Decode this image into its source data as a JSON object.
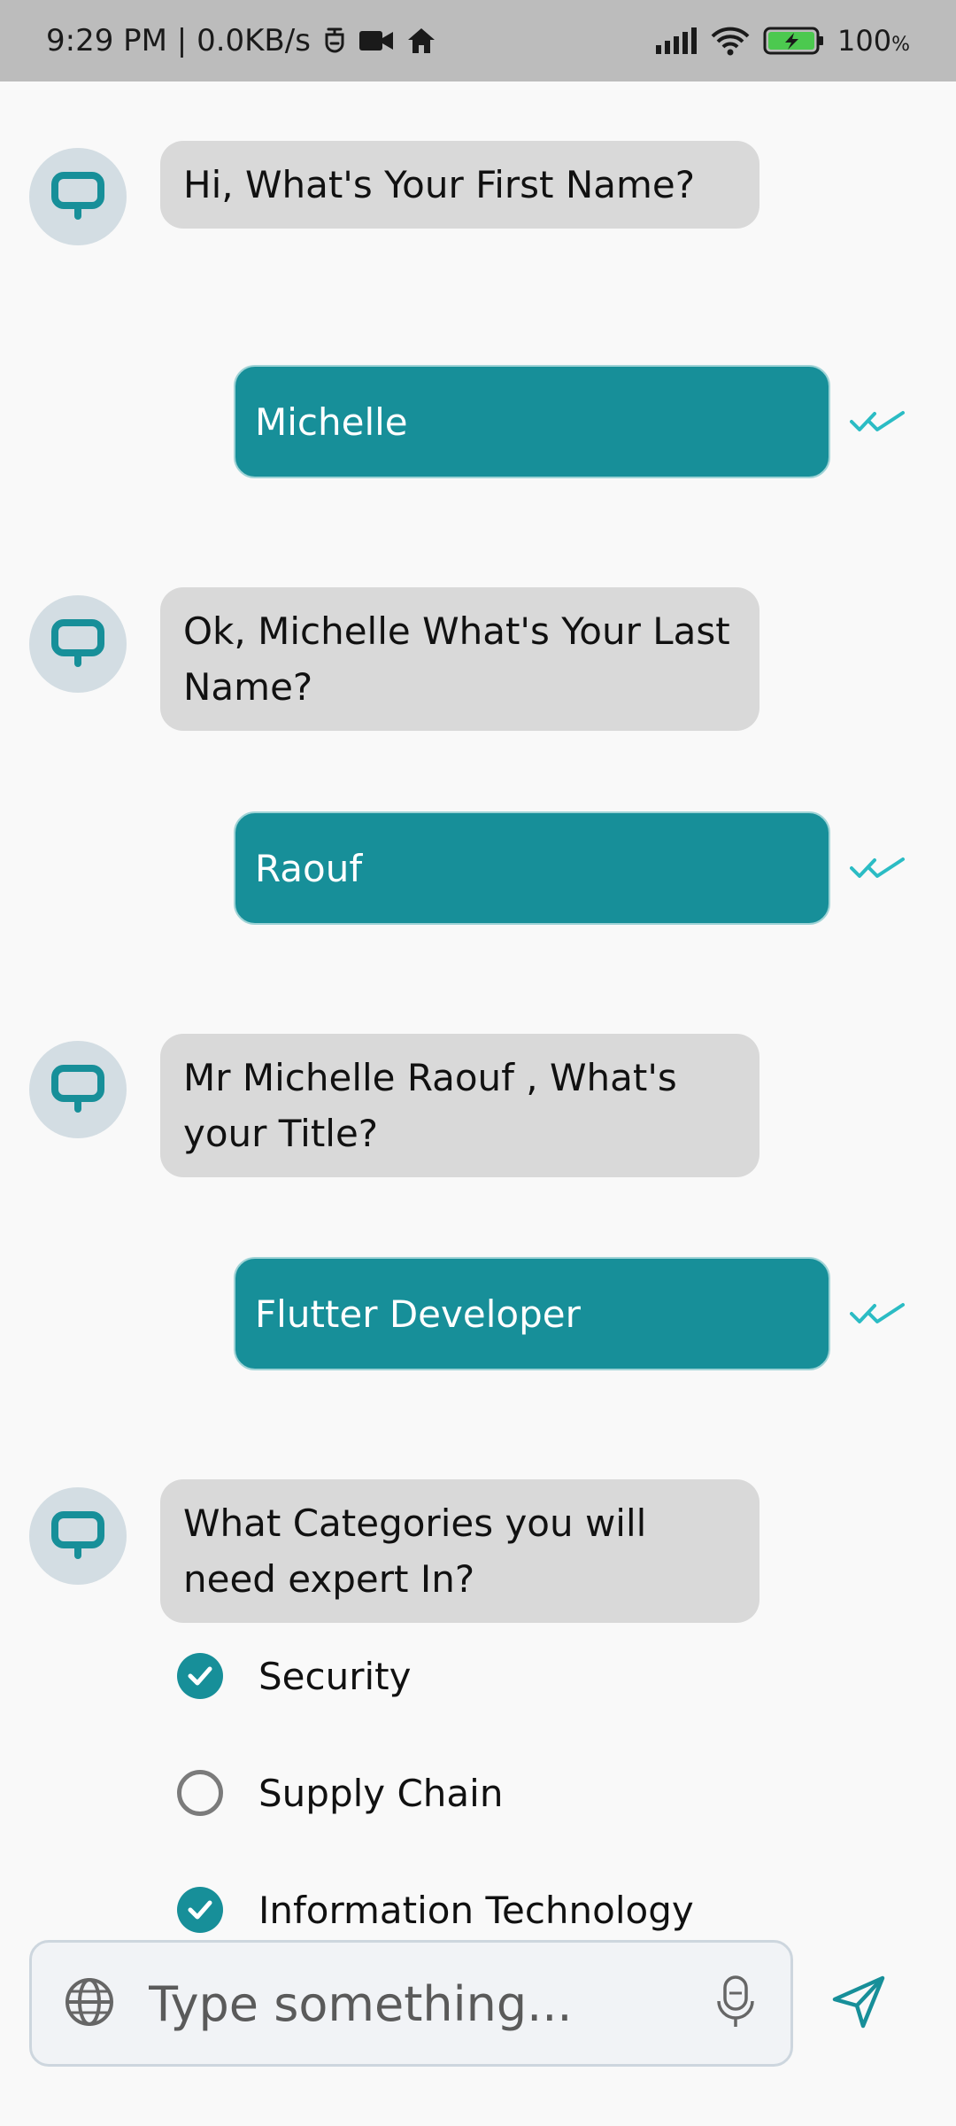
{
  "status_bar": {
    "time_and_speed": "9:29 PM | 0.0KB/s",
    "battery_text": "100",
    "battery_unit": "%",
    "icons": [
      "usb-debug-icon",
      "video-icon",
      "home-icon",
      "signal-icon",
      "wifi-icon",
      "battery-charging-icon"
    ]
  },
  "colors": {
    "accent": "#178f99",
    "bot_bubble": "#d9d9d9",
    "avatar_bg": "#d3dde3",
    "check": "#2bbcc4"
  },
  "chat": {
    "messages": [
      {
        "sender": "bot",
        "text": "Hi, What's Your First Name?"
      },
      {
        "sender": "user",
        "text": "Michelle",
        "status": "read"
      },
      {
        "sender": "bot",
        "text": "Ok, Michelle What's Your Last Name?"
      },
      {
        "sender": "user",
        "text": "Raouf",
        "status": "read"
      },
      {
        "sender": "bot",
        "text": "Mr Michelle Raouf ,  What's your Title?"
      },
      {
        "sender": "user",
        "text": "Flutter Developer",
        "status": "read"
      },
      {
        "sender": "bot",
        "text": "What Categories you will need expert In?"
      }
    ],
    "options": [
      {
        "label": "Security",
        "checked": true
      },
      {
        "label": "Supply Chain",
        "checked": false
      },
      {
        "label": "Information Technology",
        "checked": true
      }
    ]
  },
  "composer": {
    "placeholder": "Type something..."
  }
}
